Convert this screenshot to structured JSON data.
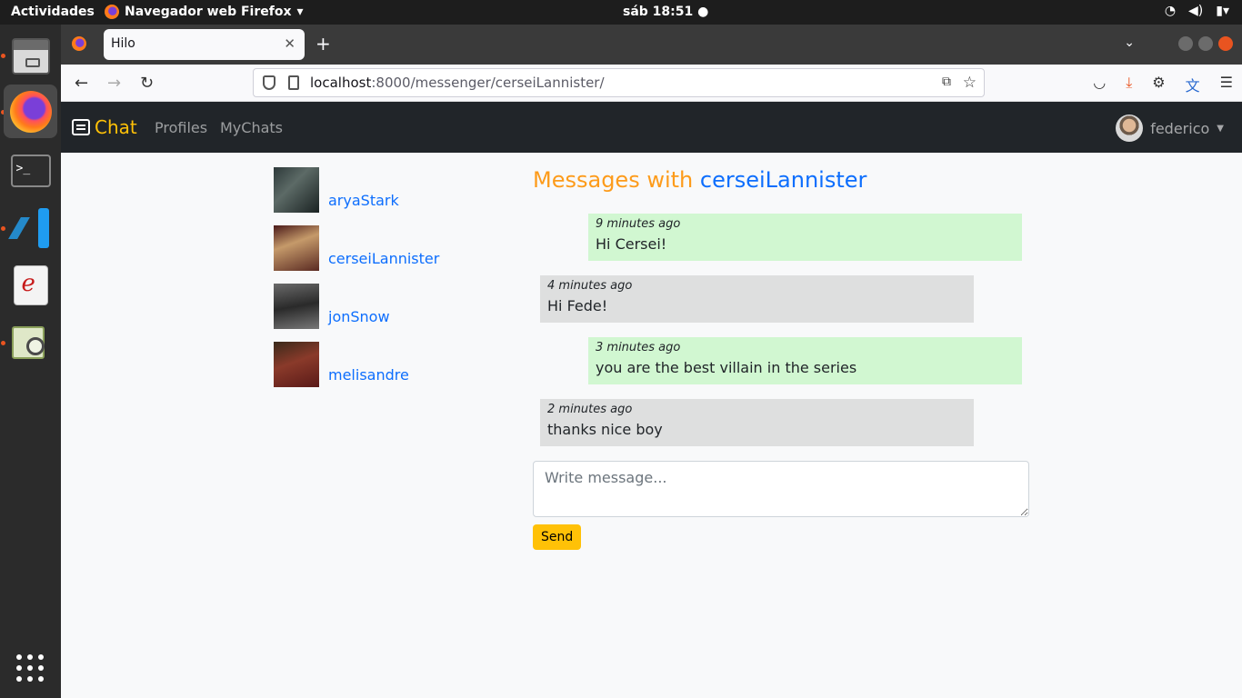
{
  "system": {
    "activities": "Actividades",
    "app_menu": "Navegador web Firefox",
    "clock": "sáb 18:51"
  },
  "browser": {
    "tab_title": "Hilo",
    "url_host": "localhost",
    "url_rest": ":8000/messenger/cerseiLannister/"
  },
  "site": {
    "brand": "Chat",
    "nav_links": [
      "Profiles",
      "MyChats"
    ],
    "username": "federico",
    "accent_color": "#ffc107",
    "link_color": "#0d6efd"
  },
  "contacts": [
    {
      "name": "aryaStark"
    },
    {
      "name": "cerseiLannister"
    },
    {
      "name": "jonSnow"
    },
    {
      "name": "melisandre"
    }
  ],
  "chat": {
    "title_prefix": "Messages with",
    "partner": "cerseiLannister",
    "messages": [
      {
        "from": "me",
        "time": "9 minutes ago",
        "text": "Hi Cersei!"
      },
      {
        "from": "them",
        "time": "4 minutes ago",
        "text": "Hi Fede!"
      },
      {
        "from": "me",
        "time": "3 minutes ago",
        "text": "you are the best villain in the series"
      },
      {
        "from": "them",
        "time": "2 minutes ago",
        "text": "thanks nice boy"
      }
    ],
    "input_placeholder": "Write message...",
    "send_label": "Send"
  }
}
